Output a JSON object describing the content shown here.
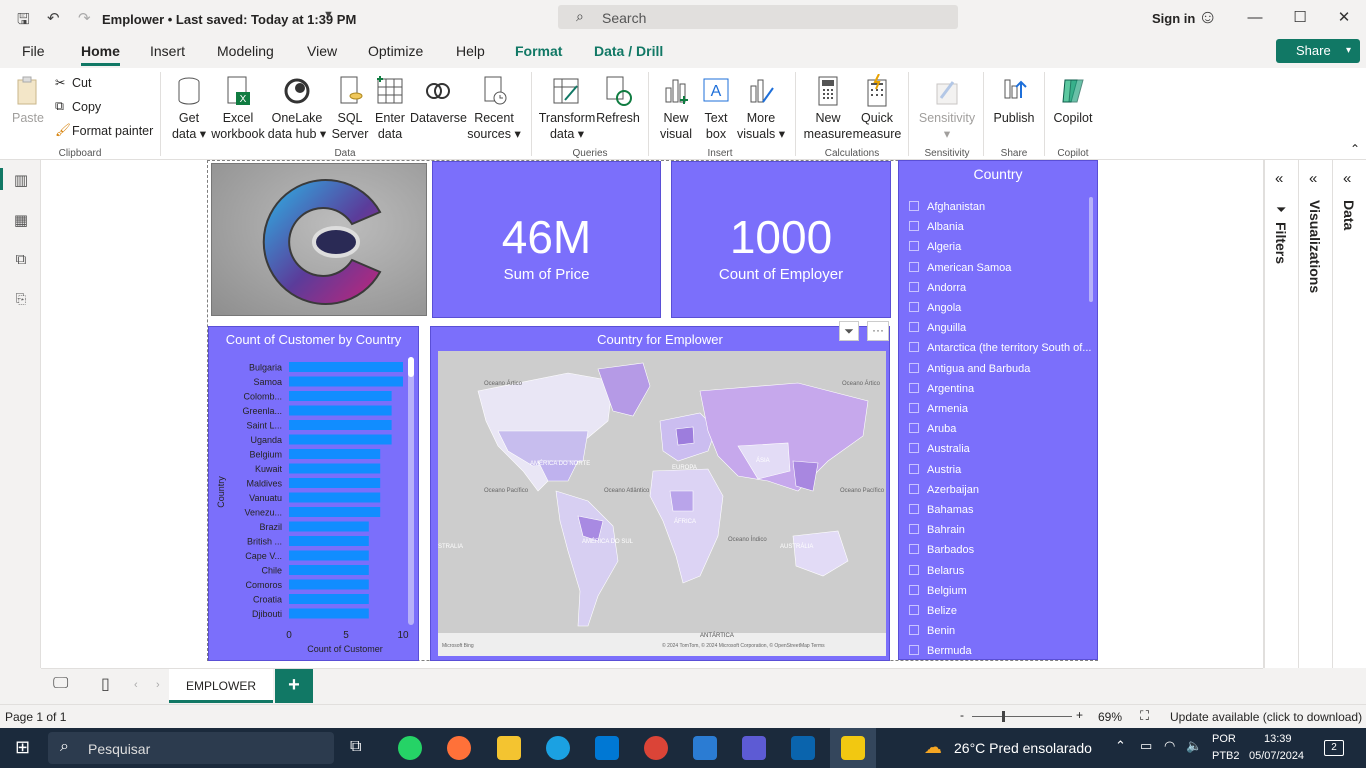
{
  "titlebar": {
    "doc_title": "Emplower • Last saved: Today at 1:39 PM",
    "search_placeholder": "Search",
    "sign_in": "Sign in"
  },
  "menubar": {
    "items": [
      "File",
      "Home",
      "Insert",
      "Modeling",
      "View",
      "Optimize",
      "Help",
      "Format",
      "Data / Drill"
    ],
    "active": "Home",
    "share": "Share"
  },
  "ribbon": {
    "clipboard": {
      "paste": "Paste",
      "cut": "Cut",
      "copy": "Copy",
      "format_painter": "Format painter",
      "group": "Clipboard"
    },
    "data": {
      "get_data": [
        "Get",
        "data ▾"
      ],
      "excel": [
        "Excel",
        "workbook"
      ],
      "onelake": [
        "OneLake",
        "data hub ▾"
      ],
      "sql": [
        "SQL",
        "Server"
      ],
      "enter": [
        "Enter",
        "data"
      ],
      "dataverse": [
        "Dataverse",
        ""
      ],
      "recent": [
        "Recent",
        "sources ▾"
      ],
      "group": "Data"
    },
    "queries": {
      "transform": [
        "Transform",
        "data ▾"
      ],
      "refresh": [
        "Refresh",
        ""
      ],
      "group": "Queries"
    },
    "insert": {
      "new_visual": [
        "New",
        "visual"
      ],
      "text_box": [
        "Text",
        "box"
      ],
      "more_visuals": [
        "More",
        "visuals ▾"
      ],
      "group": "Insert"
    },
    "calculations": {
      "new_measure": [
        "New",
        "measure"
      ],
      "quick_measure": [
        "Quick",
        "measure"
      ],
      "group": "Calculations"
    },
    "sensitivity": {
      "label": [
        "Sensitivity",
        "▾"
      ],
      "group": "Sensitivity"
    },
    "share": {
      "publish": "Publish",
      "group": "Share"
    },
    "copilot": {
      "label": "Copilot",
      "group": "Copilot"
    }
  },
  "cards": [
    {
      "value": "46M",
      "caption": "Sum of Price"
    },
    {
      "value": "1000",
      "caption": "Count of Employer"
    }
  ],
  "chart_data": {
    "type": "bar",
    "title": "Count of Customer by Country",
    "xlabel": "Count of Customer",
    "ylabel": "Country",
    "orientation": "horizontal",
    "categories": [
      "Bulgaria",
      "Samoa",
      "Colomb...",
      "Greenla...",
      "Saint L...",
      "Uganda",
      "Belgium",
      "Kuwait",
      "Maldives",
      "Vanuatu",
      "Venezu...",
      "Brazil",
      "British ...",
      "Cape V...",
      "Chile",
      "Comoros",
      "Croatia",
      "Djibouti"
    ],
    "values": [
      10,
      10,
      9,
      9,
      9,
      9,
      8,
      8,
      8,
      8,
      8,
      7,
      7,
      7,
      7,
      7,
      7,
      7
    ],
    "xlim": [
      0,
      10
    ],
    "xticks": [
      "0",
      "5",
      "10"
    ],
    "bar_color": "#118dff"
  },
  "map": {
    "title": "Country for Emplower",
    "labels": [
      "Oceano Ártico",
      "Oceano Ártico",
      "AMÉRICA DO NORTE",
      "EUROPA",
      "ÁSIA",
      "Oceano Pacífico",
      "Oceano Atlântico",
      "Oceano Pacífico",
      "ÁFRICA",
      "Oceano Índico",
      "AMÉRICA DO SUL",
      "AUSTRÁLIA",
      "STRALIA",
      "ANTÁRTICA"
    ],
    "attribution": "© 2024 TomTom, © 2024 Microsoft Corporation, © OpenStreetMap  Terms",
    "logo": "Microsoft Bing"
  },
  "slicer": {
    "title": "Country",
    "items": [
      "Afghanistan",
      "Albania",
      "Algeria",
      "American Samoa",
      "Andorra",
      "Angola",
      "Anguilla",
      "Antarctica (the territory South of...",
      "Antigua and Barbuda",
      "Argentina",
      "Armenia",
      "Aruba",
      "Australia",
      "Austria",
      "Azerbaijan",
      "Bahamas",
      "Bahrain",
      "Barbados",
      "Belarus",
      "Belgium",
      "Belize",
      "Benin",
      "Bermuda"
    ]
  },
  "panes": {
    "filters": "Filters",
    "visualizations": "Visualizations",
    "data": "Data"
  },
  "tabs": {
    "page": "EMPLOWER"
  },
  "status": {
    "page": "Page 1 of 1",
    "zoom": "69%",
    "update": "Update available (click to download)"
  },
  "taskbar": {
    "search": "Pesquisar",
    "weather": "26°C  Pred ensolarado",
    "lang": [
      "POR",
      "PTB2"
    ],
    "time": "13:39",
    "date": "05/07/2024",
    "badge": "2"
  },
  "colors": {
    "accent": "#117865",
    "tile": "#7b6ffb",
    "bar": "#118dff"
  }
}
